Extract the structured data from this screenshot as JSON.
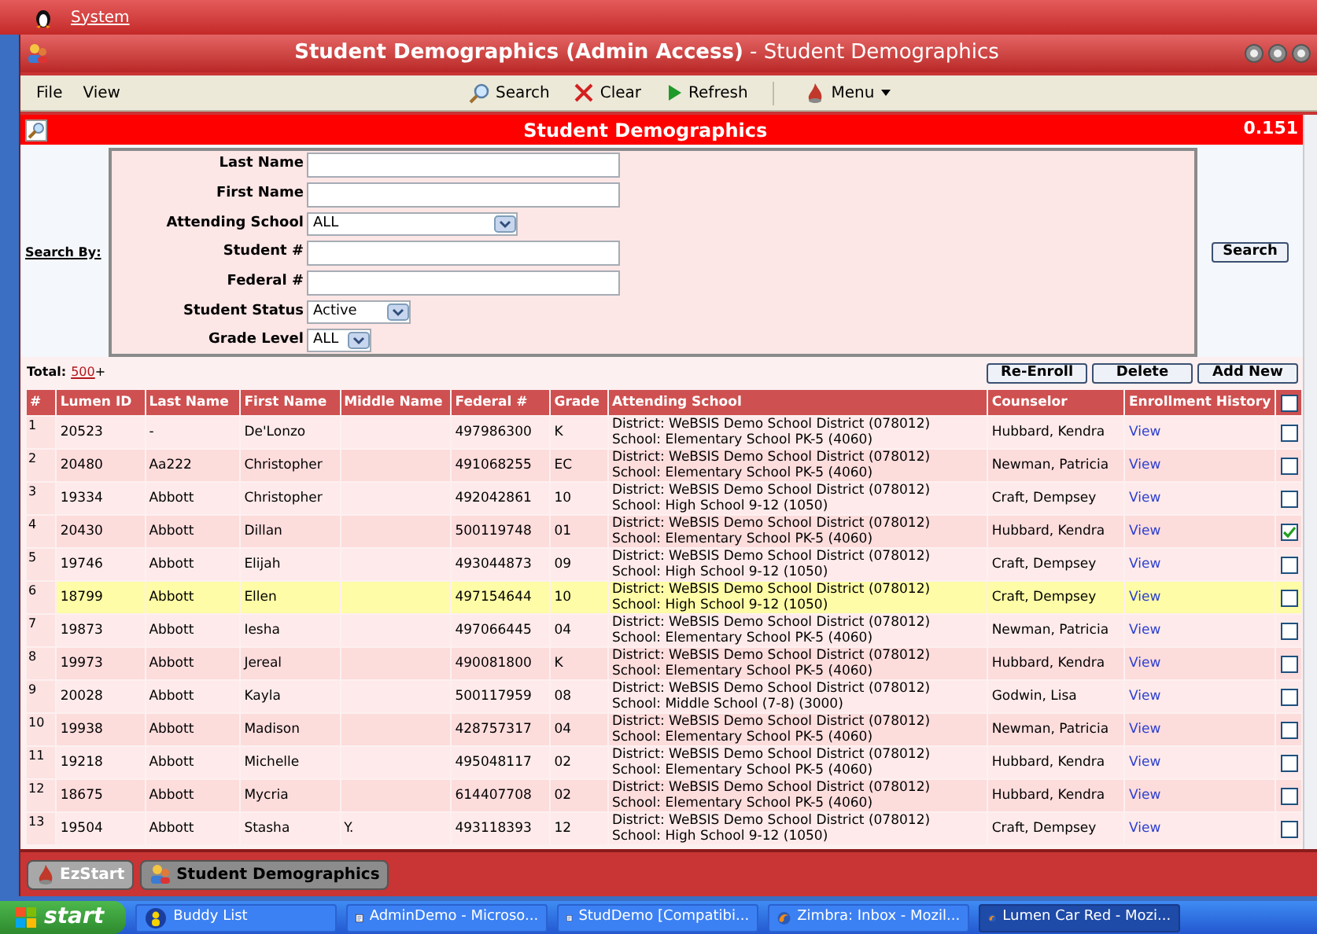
{
  "system_bar": {
    "menu": "System"
  },
  "window": {
    "title_bold": "Student Demographics (Admin Access)",
    "title_rest": " - Student Demographics"
  },
  "menu": [
    "File",
    "View"
  ],
  "toolbar": [
    {
      "kind": "search",
      "label": "Search"
    },
    {
      "kind": "clear",
      "label": "Clear"
    },
    {
      "kind": "refresh",
      "label": "Refresh"
    },
    {
      "kind": "menu",
      "label": "Menu"
    }
  ],
  "panel": {
    "title": "Student Demographics",
    "version": "0.151"
  },
  "search": {
    "label": "Search By:",
    "button": "Search",
    "fields": [
      {
        "kind": "text",
        "label": "Last Name"
      },
      {
        "kind": "text",
        "label": "First Name"
      },
      {
        "kind": "select",
        "label": "Attending School",
        "value": "ALL"
      },
      {
        "kind": "text",
        "label": "Student #"
      },
      {
        "kind": "text",
        "label": "Federal #"
      },
      {
        "kind": "select",
        "label": "Student Status",
        "value": "Active"
      },
      {
        "kind": "select",
        "label": "Grade Level",
        "value": "ALL"
      }
    ]
  },
  "total": {
    "label": "Total:",
    "count": "500",
    "suffix": "+"
  },
  "actions": [
    "Re-Enroll",
    "Delete",
    "Add New"
  ],
  "table": {
    "columns": [
      "#",
      "Lumen ID",
      "Last Name",
      "First Name",
      "Middle Name",
      "Federal #",
      "Grade",
      "Attending School",
      "Counselor",
      "Enrollment History"
    ],
    "select_all_checked": false,
    "rows": [
      {
        "n": "1",
        "id": "20523",
        "last": "-",
        "first": "De'Lonzo",
        "federal": "497986300",
        "grade": "K",
        "district": "District: WeBSIS Demo School District (078012)",
        "school": "School: Elementary School PK-5 (4060)",
        "counselor": "Hubbard, Kendra",
        "history": "View",
        "checked": false,
        "selected": false
      },
      {
        "n": "2",
        "id": "20480",
        "last": "Aa222",
        "first": "Christopher",
        "federal": "491068255",
        "grade": "EC",
        "district": "District: WeBSIS Demo School District (078012)",
        "school": "School: Elementary School PK-5 (4060)",
        "counselor": "Newman, Patricia",
        "history": "View",
        "checked": false,
        "selected": false
      },
      {
        "n": "3",
        "id": "19334",
        "last": "Abbott",
        "first": "Christopher",
        "federal": "492042861",
        "grade": "10",
        "district": "District: WeBSIS Demo School District (078012)",
        "school": "School: High School 9-12 (1050)",
        "counselor": "Craft, Dempsey",
        "history": "View",
        "checked": false,
        "selected": false
      },
      {
        "n": "4",
        "id": "20430",
        "last": "Abbott",
        "first": "Dillan",
        "federal": "500119748",
        "grade": "01",
        "district": "District: WeBSIS Demo School District (078012)",
        "school": "School: Elementary School PK-5 (4060)",
        "counselor": "Hubbard, Kendra",
        "history": "View",
        "checked": true,
        "selected": false
      },
      {
        "n": "5",
        "id": "19746",
        "last": "Abbott",
        "first": "Elijah",
        "federal": "493044873",
        "grade": "09",
        "district": "District: WeBSIS Demo School District (078012)",
        "school": "School: High School 9-12 (1050)",
        "counselor": "Craft, Dempsey",
        "history": "View",
        "checked": false,
        "selected": false
      },
      {
        "n": "6",
        "id": "18799",
        "last": "Abbott",
        "first": "Ellen",
        "federal": "497154644",
        "grade": "10",
        "district": "District: WeBSIS Demo School District (078012)",
        "school": "School: High School 9-12 (1050)",
        "counselor": "Craft, Dempsey",
        "history": "View",
        "checked": false,
        "selected": true
      },
      {
        "n": "7",
        "id": "19873",
        "last": "Abbott",
        "first": "Iesha",
        "federal": "497066445",
        "grade": "04",
        "district": "District: WeBSIS Demo School District (078012)",
        "school": "School: Elementary School PK-5 (4060)",
        "counselor": "Newman, Patricia",
        "history": "View",
        "checked": false,
        "selected": false
      },
      {
        "n": "8",
        "id": "19973",
        "last": "Abbott",
        "first": "Jereal",
        "federal": "490081800",
        "grade": "K",
        "district": "District: WeBSIS Demo School District (078012)",
        "school": "School: Elementary School PK-5 (4060)",
        "counselor": "Hubbard, Kendra",
        "history": "View",
        "checked": false,
        "selected": false
      },
      {
        "n": "9",
        "id": "20028",
        "last": "Abbott",
        "first": "Kayla",
        "federal": "500117959",
        "grade": "08",
        "district": "District: WeBSIS Demo School District (078012)",
        "school": "School: Middle School (7-8) (3000)",
        "counselor": "Godwin, Lisa",
        "history": "View",
        "checked": false,
        "selected": false
      },
      {
        "n": "10",
        "id": "19938",
        "last": "Abbott",
        "first": "Madison",
        "federal": "428757317",
        "grade": "04",
        "district": "District: WeBSIS Demo School District (078012)",
        "school": "School: Elementary School PK-5 (4060)",
        "counselor": "Newman, Patricia",
        "history": "View",
        "checked": false,
        "selected": false
      },
      {
        "n": "11",
        "id": "19218",
        "last": "Abbott",
        "first": "Michelle",
        "federal": "495048117",
        "grade": "02",
        "district": "District: WeBSIS Demo School District (078012)",
        "school": "School: Elementary School PK-5 (4060)",
        "counselor": "Hubbard, Kendra",
        "history": "View",
        "checked": false,
        "selected": false
      },
      {
        "n": "12",
        "id": "18675",
        "last": "Abbott",
        "first": "Mycria",
        "federal": "614407708",
        "grade": "02",
        "district": "District: WeBSIS Demo School District (078012)",
        "school": "School: Elementary School PK-5 (4060)",
        "counselor": "Hubbard, Kendra",
        "history": "View",
        "checked": false,
        "selected": false
      },
      {
        "n": "13",
        "id": "19504",
        "last": "Abbott",
        "first": "Stasha",
        "middle": "Y.",
        "federal": "493118393",
        "grade": "12",
        "district": "District: WeBSIS Demo School District (078012)",
        "school": "School: High School 9-12 (1050)",
        "counselor": "Craft, Dempsey",
        "history": "View",
        "checked": false,
        "selected": false
      }
    ]
  },
  "app_tabs": [
    {
      "label": "EzStart",
      "selected": false
    },
    {
      "label": "Student Demographics",
      "selected": true
    }
  ],
  "taskbar": {
    "start": "start",
    "items": [
      {
        "kind": "chat",
        "label": "Buddy List",
        "selected": false
      },
      {
        "kind": "doc",
        "label": "AdminDemo - Microso...",
        "selected": false
      },
      {
        "kind": "doc",
        "label": "StudDemo [Compatibi...",
        "selected": false
      },
      {
        "kind": "browser",
        "label": "Zimbra: Inbox - Mozil...",
        "selected": false
      },
      {
        "kind": "browser",
        "label": "Lumen Car Red - Mozi...",
        "selected": true
      }
    ]
  }
}
